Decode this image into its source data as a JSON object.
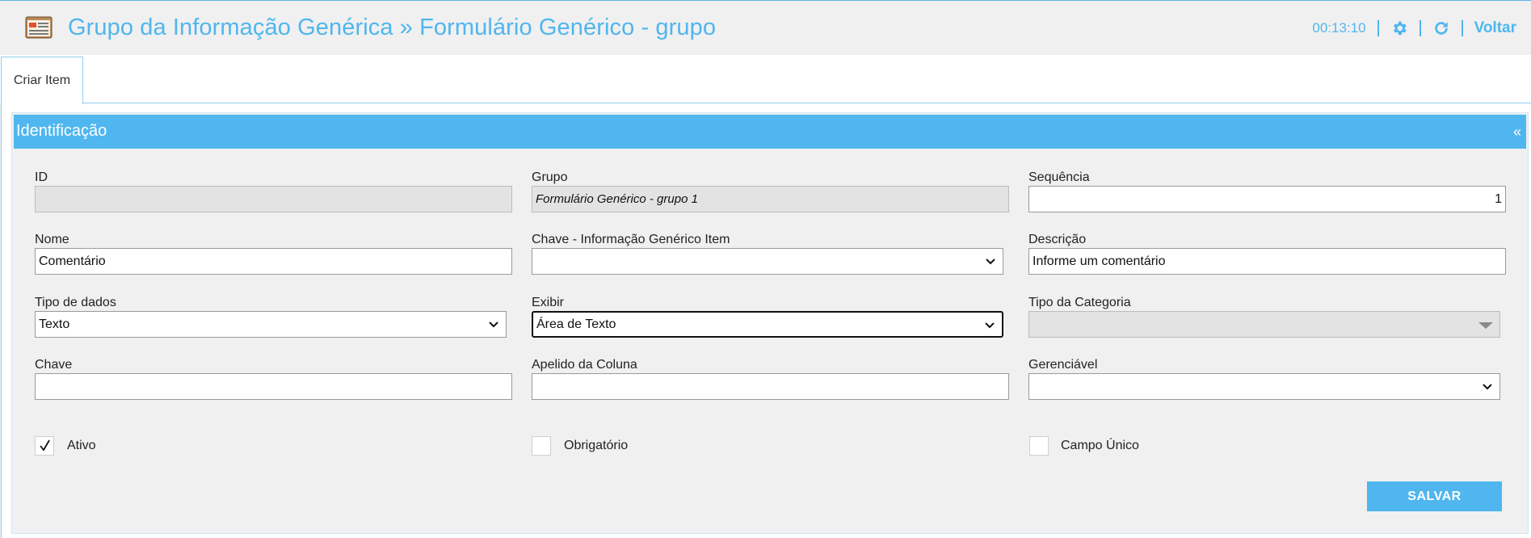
{
  "header": {
    "title": "Grupo da Informação Genérica » Formulário Genérico - grupo",
    "timer": "00:13:10",
    "back_label": "Voltar",
    "accent_color": "#4fb6ef"
  },
  "icons": {
    "app": "form-window-icon",
    "settings": "gear-icon",
    "refresh": "refresh-icon",
    "dropdown": "chevron-down-icon"
  },
  "tabs": [
    {
      "label": "Criar Item",
      "active": true
    }
  ],
  "panel": {
    "title": "Identificação",
    "collapse_symbol": "«"
  },
  "fields": {
    "id": {
      "label": "ID",
      "value": ""
    },
    "grupo": {
      "label": "Grupo",
      "value": "Formulário Genérico - grupo 1"
    },
    "sequencia": {
      "label": "Sequência",
      "value": "1"
    },
    "nome": {
      "label": "Nome",
      "value": "Comentário"
    },
    "chave_info": {
      "label": "Chave - Informação Genérico Item",
      "value": ""
    },
    "descricao": {
      "label": "Descrição",
      "value": "Informe um comentário"
    },
    "tipo_dados": {
      "label": "Tipo de dados",
      "value": "Texto"
    },
    "exibir": {
      "label": "Exibir",
      "value": "Área de Texto"
    },
    "tipo_categoria": {
      "label": "Tipo da Categoria",
      "value": ""
    },
    "chave": {
      "label": "Chave",
      "value": ""
    },
    "apelido_coluna": {
      "label": "Apelido da Coluna",
      "value": ""
    },
    "gerenciavel": {
      "label": "Gerenciável",
      "value": ""
    }
  },
  "checkboxes": {
    "ativo": {
      "label": "Ativo",
      "checked": true
    },
    "obrigatorio": {
      "label": "Obrigatório",
      "checked": false
    },
    "campo_unico": {
      "label": "Campo Único",
      "checked": false
    }
  },
  "actions": {
    "save_label": "SALVAR"
  }
}
